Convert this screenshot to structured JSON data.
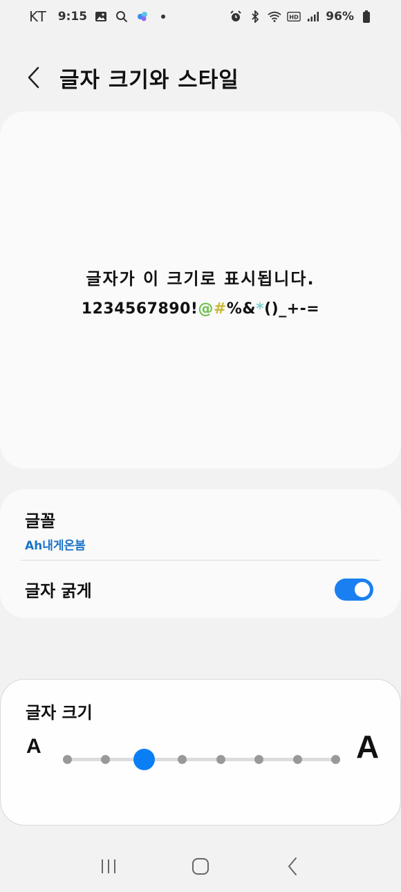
{
  "status_bar": {
    "carrier": "KT",
    "time": "9:15",
    "battery": "96%"
  },
  "header": {
    "title": "글자 크기와 스타일"
  },
  "preview": {
    "line1": "글자가 이 크기로 표시됩니다.",
    "line2_digits": "1234567890!",
    "line2_at": "@",
    "line2_hash": "#",
    "line2_mid": "%&",
    "line2_star": "*",
    "line2_rest": "()_+-="
  },
  "font_setting": {
    "label": "글꼴",
    "value": "Ah내게온봄"
  },
  "bold_setting": {
    "label": "글자 굵게",
    "enabled": true
  },
  "size_setting": {
    "label": "글자 크기",
    "small_glyph": "A",
    "large_glyph": "A",
    "steps": 8,
    "selected_step": 3
  },
  "colors": {
    "accent": "#0a7ef5",
    "link": "#1a73c8"
  }
}
